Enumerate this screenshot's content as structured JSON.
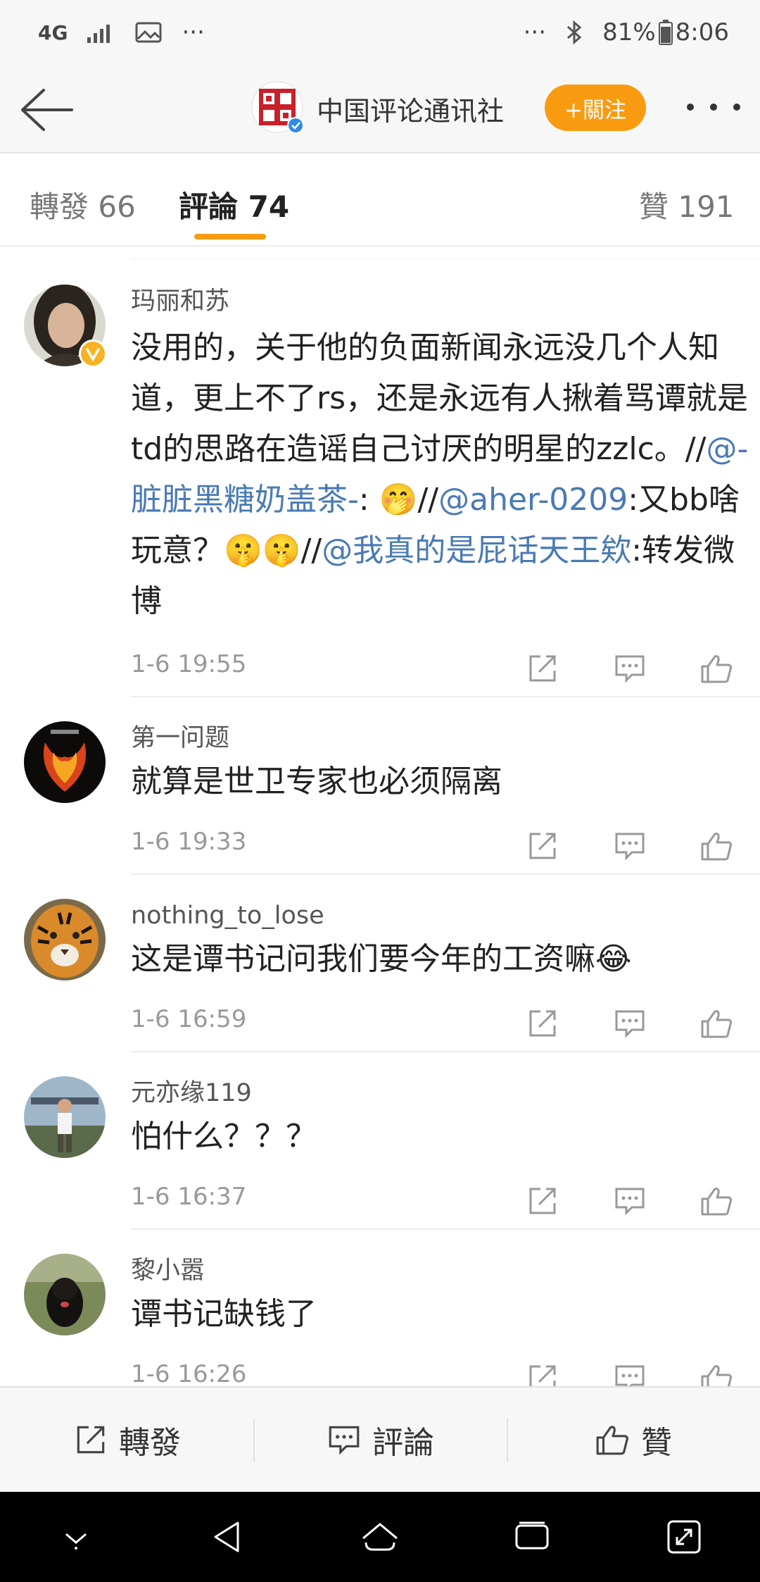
{
  "status_bar": {
    "network": "4G",
    "dots_left": "···",
    "dots_right": "···",
    "battery": "81%",
    "time": "8:06"
  },
  "header": {
    "account_name": "中国评论通讯社",
    "follow_label": "+關注",
    "accent_color": "#f99b11"
  },
  "tabs": {
    "repost": "轉發 66",
    "comment": "評論 74",
    "like": "贊 191"
  },
  "comments": [
    {
      "user": "玛丽和苏",
      "verified": true,
      "segments": [
        {
          "t": "没用的，关于他的负面新闻永远没几个人知道，更上不了rs，还是永远有人揪着骂谭就是td的思路在造谣自己讨厌的明星的zzlc。//"
        },
        {
          "t": "@-脏脏黑糖奶盖茶-",
          "at": true
        },
        {
          "t": ": 🤭//"
        },
        {
          "t": "@aher-0209",
          "at": true
        },
        {
          "t": ":又bb啥玩意？🤫🤫//"
        },
        {
          "t": "@我真的是屁话天王欸",
          "at": true
        },
        {
          "t": ":转发微博"
        }
      ],
      "time": "1-6 19:55"
    },
    {
      "user": "第一问题",
      "segments": [
        {
          "t": "就算是世卫专家也必须隔离"
        }
      ],
      "time": "1-6 19:33"
    },
    {
      "user": "nothing_to_lose",
      "segments": [
        {
          "t": "这是谭书记问我们要今年的工资嘛😂"
        }
      ],
      "time": "1-6 16:59"
    },
    {
      "user": "元亦缘119",
      "segments": [
        {
          "t": "怕什么？？？"
        }
      ],
      "time": "1-6 16:37"
    },
    {
      "user": "黎小嚣",
      "segments": [
        {
          "t": "谭书记缺钱了"
        }
      ],
      "time": "1-6 16:26"
    }
  ],
  "bottom_bar": {
    "repost": "轉發",
    "comment": "評論",
    "like": "贊"
  },
  "icons": [
    "back-arrow-icon",
    "more-icon",
    "share-icon",
    "comment-icon",
    "thumbs-up-icon"
  ]
}
